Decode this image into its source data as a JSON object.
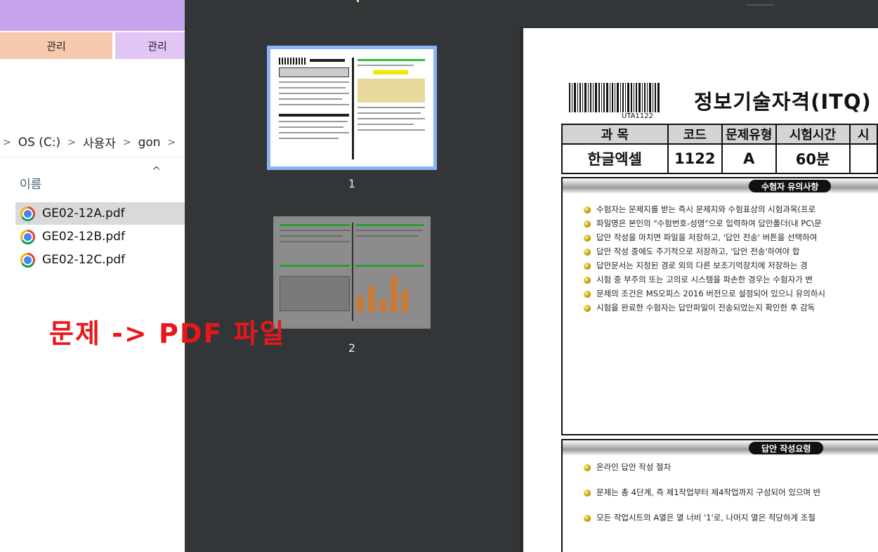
{
  "explorer": {
    "ribbon_tabs": [
      "관리",
      "관리"
    ],
    "breadcrumb": [
      "OS (C:)",
      "사용자",
      "gon"
    ],
    "breadcrumb_sep": ">",
    "column_name": "이름",
    "files": [
      {
        "name": "GE02-12A.pdf",
        "selected": true,
        "icon": "chrome-icon"
      },
      {
        "name": "GE02-12B.pdf",
        "selected": false,
        "icon": "chrome-icon"
      },
      {
        "name": "GE02-12C.pdf",
        "selected": false,
        "icon": "chrome-icon"
      }
    ]
  },
  "viewer": {
    "thumbnails": [
      {
        "page": "1",
        "selected": true
      },
      {
        "page": "2",
        "selected": false
      }
    ],
    "document": {
      "barcode_label": "UTA1122",
      "title": "정보기술자격(ITQ)",
      "table": {
        "headers": [
          "과  목",
          "코드",
          "문제유형",
          "시험시간",
          "시"
        ],
        "values": [
          "한글엑셀",
          "1122",
          "A",
          "60분",
          ""
        ]
      },
      "notice_section": {
        "title": "수험자 유의사항",
        "items": [
          "수험자는 문제지를 받는 즉시 문제지와 수험표상의 시험과목(프로",
          "파일명은 본인의 \"수험번호-성명\"으로 입력하여 답안폴더(내 PC\\문",
          "답안 작성을 마치면 파일을 저장하고, '답안 전송' 버튼을 선택하여",
          "답안 작성 중에도 주기적으로 저장하고, '답안 전송'하여야 합",
          "답안문서는 지정된 경로 외의 다른 보조기억장치에 저장하는 경",
          "시험 중 부주의 또는 고의로 시스템을 파손한 경우는 수험자가 변",
          "문제의 조건은 MS오피스 2016 버전으로 설정되어 있으니 유의하시",
          "시험을 완료한 수험자는 답안파일이 전송되었는지 확인한 후 감독"
        ]
      },
      "guide_section": {
        "title": "답안 작성요령",
        "items": [
          "온라인 답안 작성 절차",
          "문제는 총 4단계, 즉 제1작업부터 제4작업까지 구성되어 있으며 반",
          "모든 작업시트의 A열은 열 너비 '1'로, 나머지 열은 적당하게 조절"
        ]
      }
    }
  },
  "annotation": {
    "text": "문제 -> PDF 파일",
    "color": "#e8171b"
  },
  "colors": {
    "viewer_bg": "#323639",
    "thumb_selected_border": "#8ab4f8",
    "explorer_titlebar": "#c6a3ec"
  }
}
